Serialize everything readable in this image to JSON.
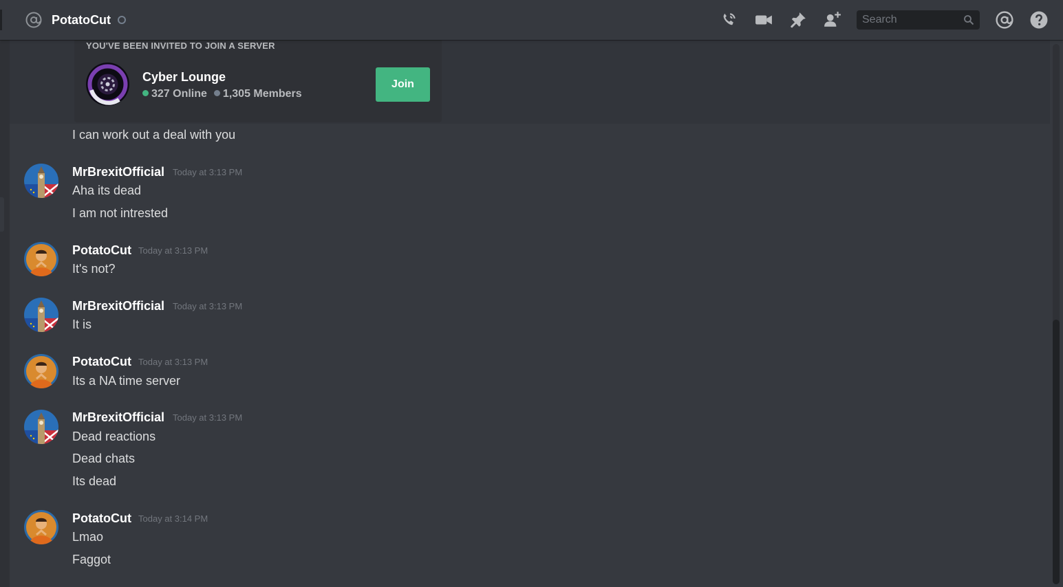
{
  "header": {
    "channel_name": "PotatoCut",
    "search_placeholder": "Search"
  },
  "invite": {
    "heading": "YOU'VE BEEN INVITED TO JOIN A SERVER",
    "server_name": "Cyber Lounge",
    "online": "327 Online",
    "members": "1,305 Members",
    "join_label": "Join"
  },
  "messages": {
    "m0_line1": "I can work out a deal with you",
    "g1": {
      "user": "MrBrexitOfficial",
      "time": "Today at 3:13 PM",
      "lines": [
        "Aha its dead",
        "I am not intrested"
      ]
    },
    "g2": {
      "user": "PotatoCut",
      "time": "Today at 3:13 PM",
      "lines": [
        "It's not?"
      ]
    },
    "g3": {
      "user": "MrBrexitOfficial",
      "time": "Today at 3:13 PM",
      "lines": [
        "It is"
      ]
    },
    "g4": {
      "user": "PotatoCut",
      "time": "Today at 3:13 PM",
      "lines": [
        "Its a NA time server"
      ]
    },
    "g5": {
      "user": "MrBrexitOfficial",
      "time": "Today at 3:13 PM",
      "lines": [
        "Dead reactions",
        "Dead chats",
        "Its dead"
      ]
    },
    "g6": {
      "user": "PotatoCut",
      "time": "Today at 3:14 PM",
      "lines": [
        "Lmao",
        "Faggot"
      ]
    }
  },
  "colors": {
    "background": "#36393f",
    "accent_green": "#43b581",
    "username": "#ffffff",
    "timestamp": "#72767d"
  },
  "icons": [
    "at-icon",
    "phone-call-icon",
    "video-call-icon",
    "pin-icon",
    "add-friend-icon",
    "search-icon",
    "mention-icon",
    "help-icon"
  ]
}
